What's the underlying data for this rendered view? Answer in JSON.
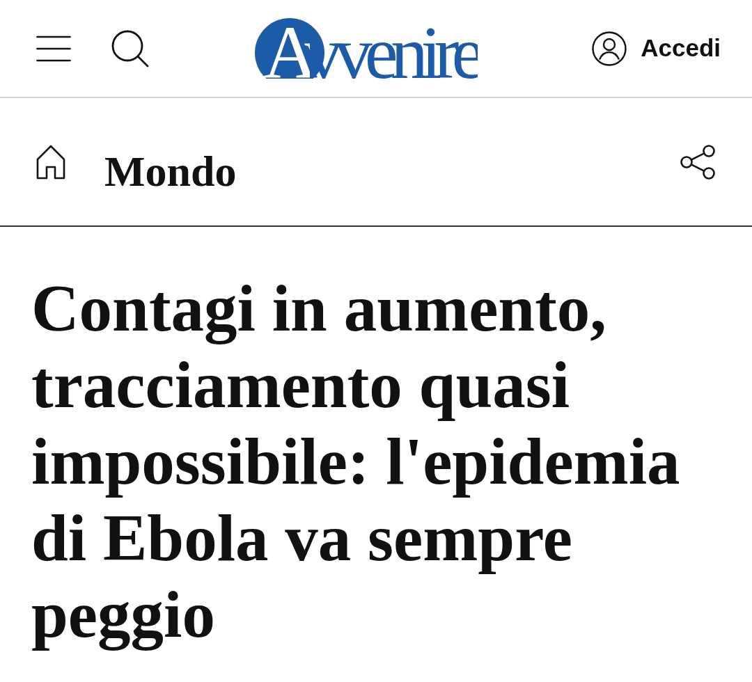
{
  "header": {
    "logo": "Avvenire",
    "login": "Accedi"
  },
  "section_bar": {
    "section": "Mondo"
  },
  "article": {
    "headline": "Contagi in aumento, tracciamento quasi impossibile: l'epidemia di Ebola va sempre peggio"
  }
}
